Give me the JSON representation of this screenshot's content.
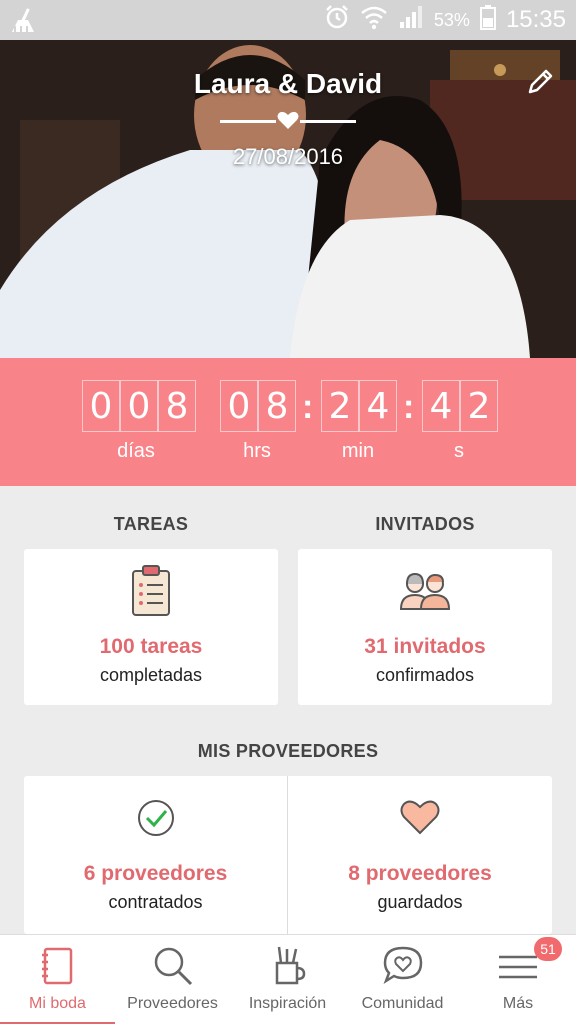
{
  "status_bar": {
    "battery_percent": "53%",
    "time": "15:35"
  },
  "hero": {
    "couple_names": "Laura & David",
    "wedding_date": "27/08/2016"
  },
  "countdown": {
    "days": [
      "0",
      "0",
      "8"
    ],
    "hours": [
      "0",
      "8"
    ],
    "minutes": [
      "2",
      "4"
    ],
    "seconds": [
      "4",
      "2"
    ],
    "labels": {
      "days": "días",
      "hours": "hrs",
      "minutes": "min",
      "seconds": "s"
    }
  },
  "tasks": {
    "title": "TAREAS",
    "primary": "100 tareas",
    "secondary": "completadas"
  },
  "guests": {
    "title": "INVITADOS",
    "primary": "31 invitados",
    "secondary": "confirmados"
  },
  "vendors": {
    "title": "MIS PROVEEDORES",
    "hired": {
      "primary": "6 proveedores",
      "secondary": "contratados"
    },
    "saved": {
      "primary": "8 proveedores",
      "secondary": "guardados"
    }
  },
  "bottom_nav": {
    "items": [
      {
        "label": "Mi boda",
        "icon": "notebook-icon",
        "active": true
      },
      {
        "label": "Proveedores",
        "icon": "search-icon"
      },
      {
        "label": "Inspiración",
        "icon": "pencil-cup-icon"
      },
      {
        "label": "Comunidad",
        "icon": "chat-heart-icon"
      },
      {
        "label": "Más",
        "icon": "menu-icon",
        "badge": "51"
      }
    ]
  },
  "colors": {
    "accent": "#f8848a",
    "accent_text": "#e06a6f"
  }
}
